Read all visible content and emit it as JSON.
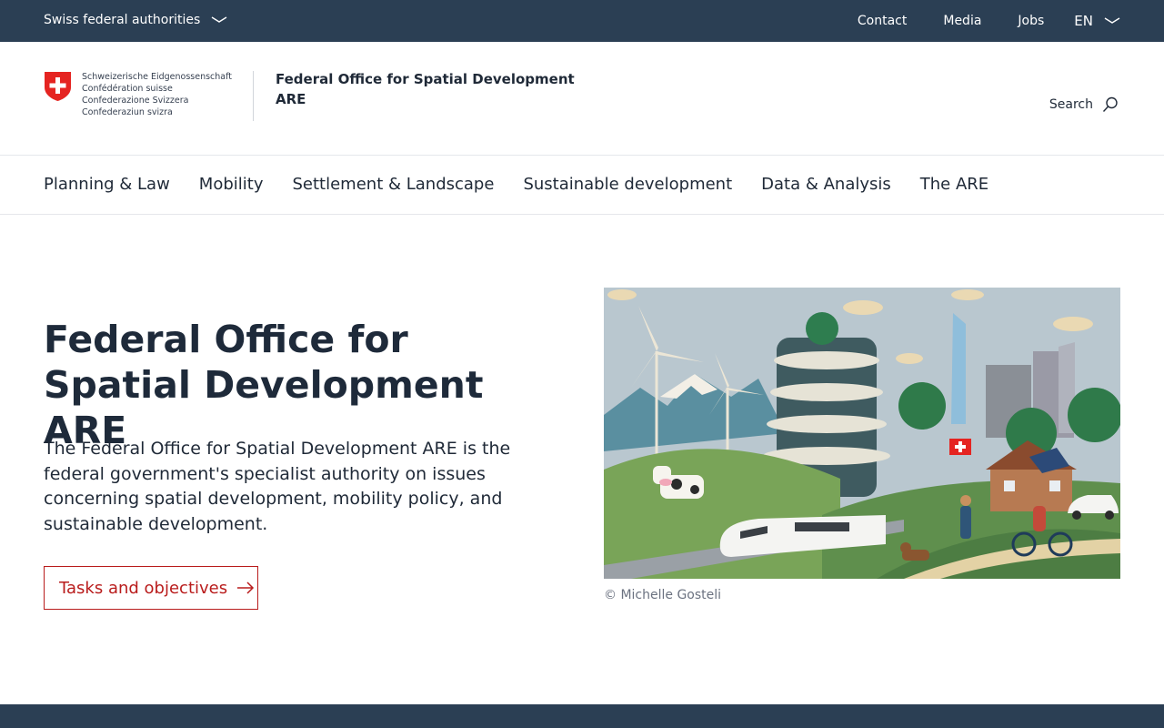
{
  "topbar": {
    "authorities_label": "Swiss federal authorities",
    "links": [
      "Contact",
      "Media",
      "Jobs"
    ],
    "language": "EN"
  },
  "header": {
    "confederation_names": [
      "Schweizerische Eidgenossenschaft",
      "Confédération suisse",
      "Confederazione Svizzera",
      "Confederaziun svizra"
    ],
    "office_line1": "Federal Office for Spatial Development",
    "office_line2": "ARE",
    "search_label": "Search"
  },
  "nav": {
    "items": [
      "Planning & Law",
      "Mobility",
      "Settlement & Landscape",
      "Sustainable development",
      "Data & Analysis",
      "The ARE"
    ]
  },
  "hero": {
    "title": "Federal Office for Spatial Development ARE",
    "description": "The Federal Office for Spatial Development ARE is the federal government's specialist authority on issues concerning spatial development, mobility policy, and sustainable development.",
    "button_label": "Tasks and objectives",
    "image_caption": "© Michelle Gosteli"
  },
  "colors": {
    "dark_bar": "#2b3f54",
    "accent_red": "#b91c1c",
    "swiss_red": "#e52421"
  }
}
